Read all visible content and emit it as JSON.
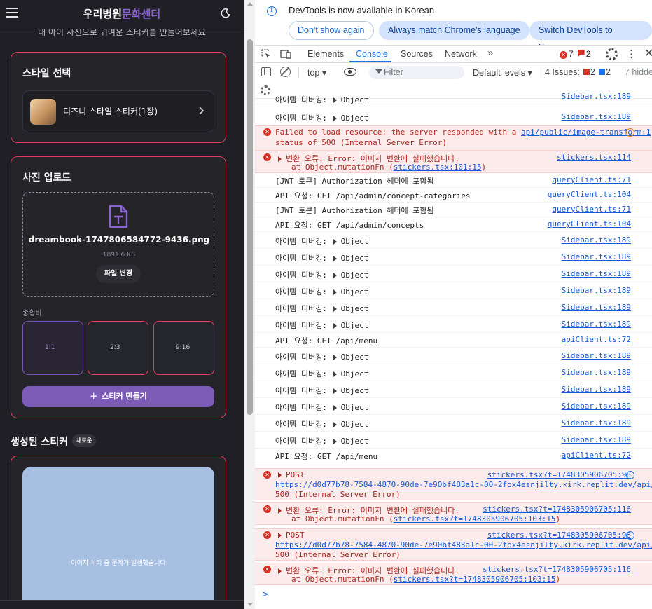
{
  "app": {
    "brand_part1": "우리병원",
    "brand_part2": "문화센터",
    "subtitle": "내 아이 사진으로 귀여운 스티커를 만들어보세요",
    "style_section": {
      "title": "스타일 선택",
      "selected_label": "디즈니 스타일 스티커(1장)"
    },
    "upload_section": {
      "title": "사진 업로드",
      "file_name": "dreambook-1747806584772-9436.png",
      "file_size": "1891.6 KB",
      "change_button": "파일 변경",
      "ratio_label": "종횡비",
      "ratios": [
        "1:1",
        "2:3",
        "9:16"
      ],
      "selected_ratio": "1:1",
      "make_button": "스티커 만들기"
    },
    "generated": {
      "title": "생성된 스티커",
      "badge": "새로운",
      "error_message": "이미지 처리 중 문제가 발생했습니다"
    },
    "colors": {
      "accent": "#7c5bb7",
      "border": "#e0405d",
      "background": "#1f1f25",
      "result_placeholder": "#a7bfe1"
    }
  },
  "devtools": {
    "infobar": {
      "text": "DevTools is now available in Korean",
      "btn_dont_show": "Don't show again",
      "btn_match": "Always match Chrome's language",
      "btn_switch": "Switch DevTools to Korean"
    },
    "tabs": [
      "Elements",
      "Console",
      "Sources",
      "Network"
    ],
    "active_tab": "Console",
    "error_count": "7",
    "warning_count": "2",
    "toolbar": {
      "context": "top",
      "filter_placeholder": "Filter",
      "levels": "Default levels",
      "issues_label": "4 Issues:",
      "issues_errors": "2",
      "issues_info": "2",
      "hidden": "7 hidden"
    },
    "console": [
      {
        "msg": "아이템 디버깅:",
        "obj": "Object",
        "src": "Sidebar.tsx:189",
        "cut": true
      },
      {
        "msg": "아이템 디버깅:",
        "obj": "Object",
        "src": "Sidebar.tsx:189"
      },
      {
        "err1": "Failed to load resource: the server responded with a",
        "err_link": "api/public/image-transform:1",
        "err2": "status of 500 (Internal Server Error)"
      },
      {
        "err1": "변환 오류: Error: 이미지 변환에 실패했습니다.",
        "err2_pre": "at Object.mutationFn (",
        "err2_link": "stickers.tsx:101:15",
        "err2_post": ")",
        "src": "stickers.tsx:114"
      },
      {
        "msg": "[JWT 토큰] Authorization 헤더에 포함됨",
        "src": "queryClient.ts:71"
      },
      {
        "msg": "API 요청: GET /api/admin/concept-categories",
        "src": "queryClient.ts:104"
      },
      {
        "msg": "[JWT 토큰] Authorization 헤더에 포함됨",
        "src": "queryClient.ts:71"
      },
      {
        "msg": "API 요청: GET /api/admin/concepts",
        "src": "queryClient.ts:104"
      },
      {
        "msg": "아이템 디버깅:",
        "obj": "Object",
        "src": "Sidebar.tsx:189"
      },
      {
        "msg": "아이템 디버깅:",
        "obj": "Object",
        "src": "Sidebar.tsx:189"
      },
      {
        "msg": "아이템 디버깅:",
        "obj": "Object",
        "src": "Sidebar.tsx:189"
      },
      {
        "msg": "아이템 디버깅:",
        "obj": "Object",
        "src": "Sidebar.tsx:189"
      },
      {
        "msg": "아이템 디버깅:",
        "obj": "Object",
        "src": "Sidebar.tsx:189"
      },
      {
        "msg": "아이템 디버깅:",
        "obj": "Object",
        "src": "Sidebar.tsx:189"
      },
      {
        "msg": "API 요청: GET /api/menu",
        "src": "apiClient.ts:72"
      },
      {
        "msg": "아이템 디버깅:",
        "obj": "Object",
        "src": "Sidebar.tsx:189"
      },
      {
        "msg": "아이템 디버깅:",
        "obj": "Object",
        "src": "Sidebar.tsx:189"
      },
      {
        "msg": "아이템 디버깅:",
        "obj": "Object",
        "src": "Sidebar.tsx:189"
      },
      {
        "msg": "아이템 디버깅:",
        "obj": "Object",
        "src": "Sidebar.tsx:189"
      },
      {
        "msg": "아이템 디버깅:",
        "obj": "Object",
        "src": "Sidebar.tsx:189"
      },
      {
        "msg": "아이템 디버깅:",
        "obj": "Object",
        "src": "Sidebar.tsx:189"
      },
      {
        "msg": "API 요청: GET /api/menu",
        "src": "apiClient.ts:72"
      },
      {
        "err1": "POST",
        "err_url": "https://d0d77b78-7584-4870-90de-7e90bf483a1c-00-2fox4esnjilty.kirk.replit.dev/api/p…",
        "err3": "500 (Internal Server Error)",
        "src": "stickers.tsx?t=1748305906705:98"
      },
      {
        "err1": "변환 오류: Error: 이미지 변환에 실패했습니다.",
        "err2_pre": "at Object.mutationFn (",
        "err2_link": "stickers.tsx?t=1748305906705:103:15",
        "err2_post": ")",
        "src": "stickers.tsx?t=1748305906705:116"
      },
      {
        "err1": "POST",
        "err_url": "https://d0d77b78-7584-4870-90de-7e90bf483a1c-00-2fox4esnjilty.kirk.replit.dev/api/p…",
        "err3": "500 (Internal Server Error)",
        "src": "stickers.tsx?t=1748305906705:98"
      },
      {
        "err1": "변환 오류: Error: 이미지 변환에 실패했습니다.",
        "err2_pre": "at Object.mutationFn (",
        "err2_link": "stickers.tsx?t=1748305906705:103:15",
        "err2_post": ")",
        "src": "stickers.tsx?t=1748305906705:116"
      }
    ],
    "prompt": ">"
  }
}
